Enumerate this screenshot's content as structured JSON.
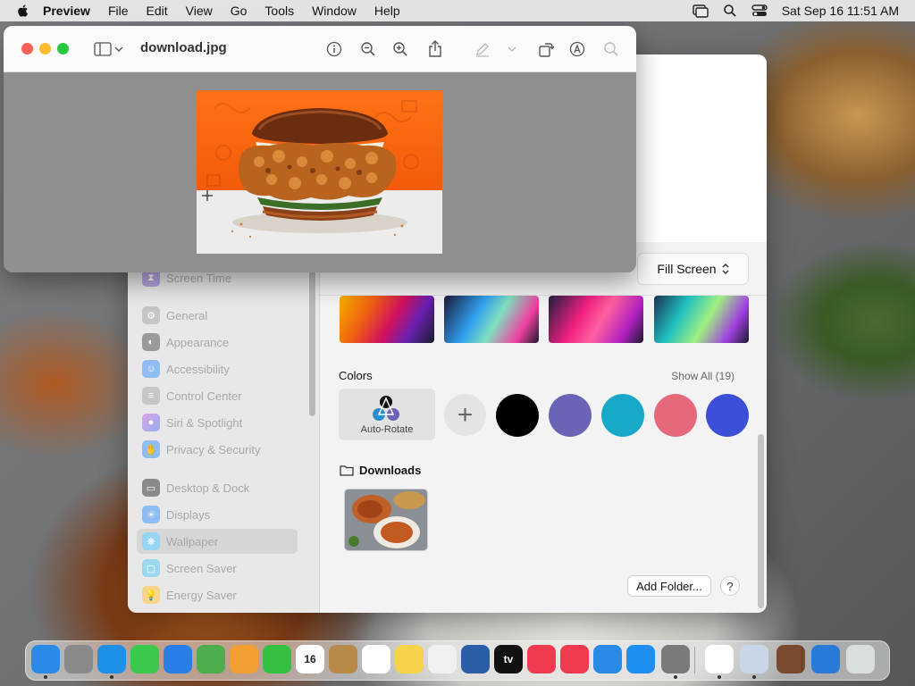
{
  "menubar": {
    "app_name": "Preview",
    "items": [
      "File",
      "Edit",
      "View",
      "Go",
      "Tools",
      "Window",
      "Help"
    ],
    "clock": "Sat Sep 16  11:51 AM"
  },
  "preview": {
    "title": "download.jpg"
  },
  "settings": {
    "sidebar": [
      {
        "label": "Screen Time",
        "icon": "hourglass-icon",
        "color": "#8a5cd0"
      },
      {
        "label": "General",
        "icon": "gear-icon",
        "color": "#8e8e93"
      },
      {
        "label": "Appearance",
        "icon": "appearance-icon",
        "color": "#1c1c1e"
      },
      {
        "label": "Accessibility",
        "icon": "accessibility-icon",
        "color": "#1a7cf5"
      },
      {
        "label": "Control Center",
        "icon": "control-center-icon",
        "color": "#8e8e93"
      },
      {
        "label": "Siri & Spotlight",
        "icon": "siri-icon",
        "color": "#c050d0"
      },
      {
        "label": "Privacy & Security",
        "icon": "hand-icon",
        "color": "#1a7cf5"
      },
      {
        "label": "Desktop & Dock",
        "icon": "dock-icon",
        "color": "#1c1c1e"
      },
      {
        "label": "Displays",
        "icon": "sun-icon",
        "color": "#1a7cf5"
      },
      {
        "label": "Wallpaper",
        "icon": "wallpaper-icon",
        "color": "#30b0e8"
      },
      {
        "label": "Screen Saver",
        "icon": "screensaver-icon",
        "color": "#30c0e0"
      },
      {
        "label": "Energy Saver",
        "icon": "bulb-icon",
        "color": "#f0b020"
      }
    ],
    "fill_mode": "Fill Screen",
    "colors_label": "Colors",
    "show_all": "Show All (19)",
    "auto_rotate": "Auto-Rotate",
    "swatches": [
      "#000000",
      "#6b63b5",
      "#18a9c9",
      "#e5697a",
      "#3b4fd8"
    ],
    "downloads_label": "Downloads",
    "add_folder": "Add Folder...",
    "help": "?"
  },
  "dock": [
    {
      "name": "finder",
      "color": "#2a8ae8"
    },
    {
      "name": "launchpad",
      "color": "#8a8a8a"
    },
    {
      "name": "safari",
      "color": "#1e90e8"
    },
    {
      "name": "messages",
      "color": "#3cc84c"
    },
    {
      "name": "mail",
      "color": "#2a7ee8"
    },
    {
      "name": "maps",
      "color": "#4cae4c"
    },
    {
      "name": "photos",
      "color": "#f0a030"
    },
    {
      "name": "facetime",
      "color": "#34c040"
    },
    {
      "name": "calendar",
      "color": "#ffffff",
      "text": "16"
    },
    {
      "name": "contacts",
      "color": "#b88a4a"
    },
    {
      "name": "reminders",
      "color": "#ffffff"
    },
    {
      "name": "notes",
      "color": "#f6d34a"
    },
    {
      "name": "freeform",
      "color": "#f0f0f0"
    },
    {
      "name": "virtualbox",
      "color": "#2a5ea8"
    },
    {
      "name": "apple-tv",
      "color": "#111111",
      "text": "tv"
    },
    {
      "name": "music",
      "color": "#f03a50"
    },
    {
      "name": "news",
      "color": "#f03a50"
    },
    {
      "name": "keynote",
      "color": "#2a8ae8"
    },
    {
      "name": "app-store",
      "color": "#1e8ef0"
    },
    {
      "name": "system-settings",
      "color": "#7a7a7a"
    },
    {
      "name": "chrome",
      "color": "#ffffff"
    },
    {
      "name": "preview",
      "color": "#c9d6e8"
    },
    {
      "name": "downloads-stack",
      "color": "#7a4a30"
    },
    {
      "name": "globe",
      "color": "#2a7ad8"
    },
    {
      "name": "trash",
      "color": "#d8dde0"
    }
  ]
}
